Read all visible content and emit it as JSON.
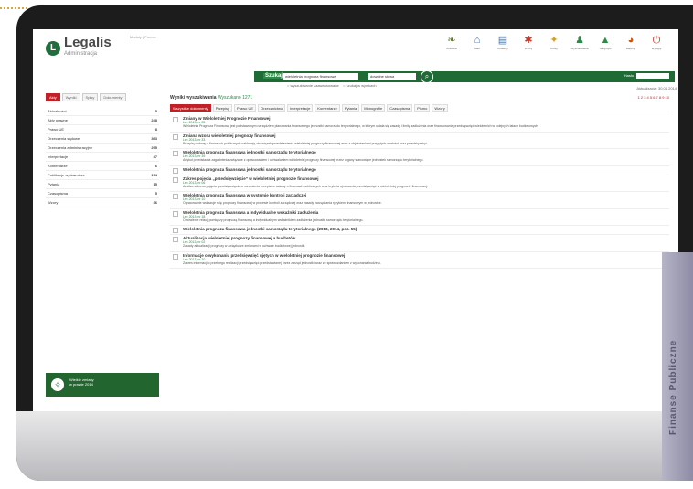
{
  "app": {
    "logo_text": "Legalis",
    "logo_sub": "Administracja",
    "top_note": "Moduły | Pomoc"
  },
  "toolbar": [
    {
      "icon": "bookmark-icon",
      "label": "Ulubione"
    },
    {
      "icon": "home-icon",
      "label": "Start"
    },
    {
      "icon": "book-icon",
      "label": "Kodeksy"
    },
    {
      "icon": "star-icon",
      "label": "Wzory"
    },
    {
      "icon": "graduation-icon",
      "label": "Kursy"
    },
    {
      "icon": "person-icon",
      "label": "Wyszukiwarka"
    },
    {
      "icon": "chart-icon",
      "label": "Statystyki"
    },
    {
      "icon": "pie-icon",
      "label": "Raporty"
    },
    {
      "icon": "exit-icon",
      "label": "Wyloguj"
    }
  ],
  "search": {
    "brand": "Szukaj",
    "value": "wieloletnia prognoza finansowa",
    "select": "dowolne słowa",
    "opt_a": "○ wyszukiwanie zaawansowane",
    "opt_b": "○ szukaj w wynikach",
    "user_label": "Hasło",
    "user_value": "",
    "date": "Aktualizacja: 30.04.2014"
  },
  "sidebar": {
    "tabs": [
      "Akty",
      "Wyniki",
      "Spisy",
      "Dokumenty"
    ],
    "items": [
      {
        "label": "Aktualności",
        "count": "5"
      },
      {
        "label": "Akty prawne",
        "count": "248"
      },
      {
        "label": "Prawo UE",
        "count": "8"
      },
      {
        "label": "Orzeczenia sądowe",
        "count": "363"
      },
      {
        "label": "Orzeczenia administracyjne",
        "count": "295"
      },
      {
        "label": "Interpretacje",
        "count": "47"
      },
      {
        "label": "Komentarze",
        "count": "6"
      },
      {
        "label": "Publikacje wydawnicze",
        "count": "174"
      },
      {
        "label": "Pytania",
        "count": "15"
      },
      {
        "label": "Czasopisma",
        "count": "5"
      },
      {
        "label": "Wzory",
        "count": "36"
      }
    ],
    "ad_title": "Wielkie zmiany",
    "ad_line": "w prawie 2014"
  },
  "main": {
    "title": "Wyniki wyszukiwania",
    "subtitle": "Wyszukano 1271",
    "pager": "1 2 3 4 5 6 7 8 9 10",
    "tabs": [
      "Wszystkie dokumenty",
      "Przepisy",
      "Prawo UE",
      "Orzecznictwo",
      "Interpretacje",
      "Komentarze",
      "Pytania",
      "Monografie",
      "Czasopisma",
      "Pismo",
      "Wzory"
    ],
    "docs": [
      {
        "title": "Zmiany w Wieloletniej Prognozie Finansowej",
        "meta": "Lex 2013, nr 28",
        "text": "Wieloletnia Prognoza Finansowa jest podstawowym narzędziem planowania finansowego jednostki samorządu terytorialnego, w którym ustala się zasady i limity zadłużenia oraz finansowania przedsięwzięć wieloletnich w kolejnych latach budżetowych."
      },
      {
        "title": "Zmiana wzoru wieloletniej prognozy finansowej",
        "meta": "Lex 2013, nr 33",
        "text": "Przepisy ustawy o finansach publicznych nakładają obowiązek przedstawienia wieloletniej prognozy finansowej wraz z objaśnieniami przyjętych wartości oraz przedsięwzięć."
      },
      {
        "title": "Wieloletnia prognoza finansowa jednostki samorządu terytorialnego",
        "meta": "Lex 2013, nr 39",
        "text": "Artykuł przedstawia zagadnienia związane z opracowaniem i uchwalaniem wieloletniej prognozy finansowej przez organy stanowiące jednostek samorządu terytorialnego."
      },
      {
        "title": "Wieloletnia prognoza finansowa jednostki samorządu terytorialnego",
        "meta": "",
        "text": ""
      },
      {
        "title": "Zakres pojęcia „przedsięwzięcie” w wieloletniej prognozie finansowej",
        "meta": "Lex 2013, nr 06",
        "text": "Analiza zakresu pojęcia przedsięwzięcia w rozumieniu przepisów ustawy o finansach publicznych oraz kryteria ujmowania przedsięwzięć w wieloletniej prognozie finansowej."
      },
      {
        "title": "Wieloletnia prognoza finansowa w systemie kontroli zarządczej",
        "meta": "Lex 2013, nr 10",
        "text": "Opracowanie wskazuje rolę prognozy finansowej w procesie kontroli zarządczej oraz zasady zarządzania ryzykiem finansowym w jednostce."
      },
      {
        "title": "Wieloletnia prognoza finansowa a indywidualne wskaźniki zadłużenia",
        "meta": "Lex 2013, nr 18",
        "text": "Omówienie relacji pomiędzy prognozą finansową a indywidualnym wskaźnikiem zadłużenia jednostki samorządu terytorialnego."
      },
      {
        "title": "Wieloletnia prognoza finansowa jednostki samorządu terytorialnego (2013, 2014, poz. 55)",
        "meta": "",
        "text": ""
      },
      {
        "title": "Aktualizacja wieloletniej prognozy finansowej a budżetów",
        "meta": "Lex 2013, nr 02",
        "text": "Zasady aktualizacji prognozy w związku ze zmianami w uchwale budżetowej jednostki."
      },
      {
        "title": "Informacje o wykonaniu przedsięwzięć ujętych w wieloletniej prognozie finansowej",
        "meta": "Lex 2013, nr 20",
        "text": "Zakres informacji o przebiegu realizacji przedsięwzięć przedstawianej przez zarząd jednostki wraz ze sprawozdaniem z wykonania budżetu."
      }
    ]
  },
  "side_tab": "Finanse Publiczne"
}
